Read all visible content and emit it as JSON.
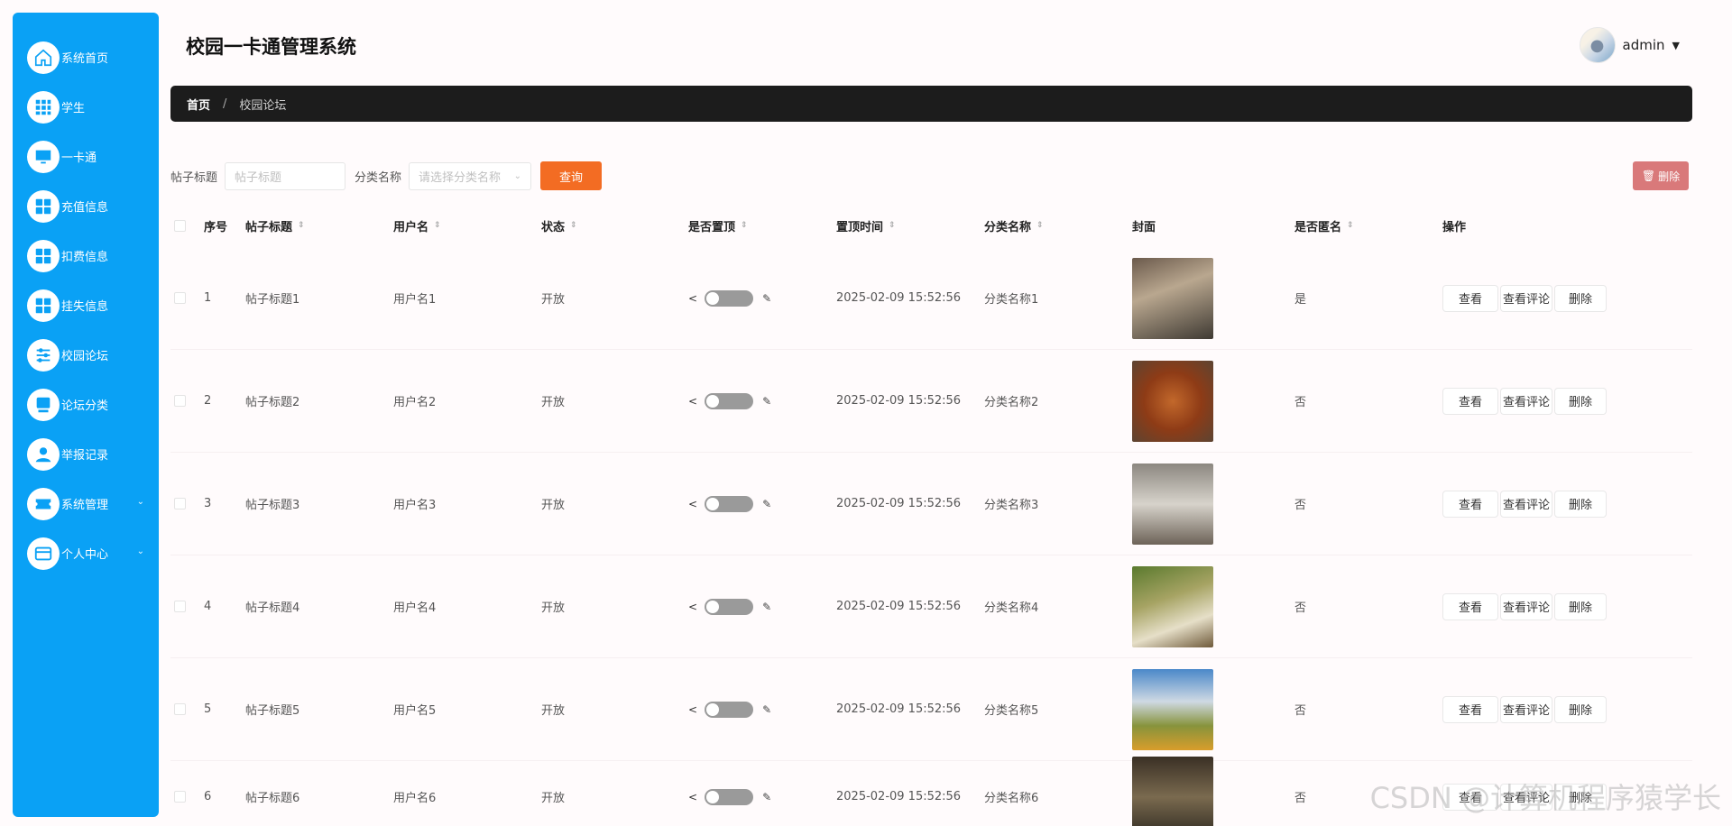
{
  "app": {
    "title": "校园一卡通管理系统"
  },
  "user": {
    "name": "admin"
  },
  "sidebar": {
    "items": [
      {
        "label": "系统首页",
        "icon": "home-icon"
      },
      {
        "label": "学生",
        "icon": "grid-dots-icon"
      },
      {
        "label": "一卡通",
        "icon": "monitor-icon"
      },
      {
        "label": "充值信息",
        "icon": "apps-icon"
      },
      {
        "label": "扣费信息",
        "icon": "apps-icon"
      },
      {
        "label": "挂失信息",
        "icon": "apps-icon"
      },
      {
        "label": "校园论坛",
        "icon": "sliders-icon"
      },
      {
        "label": "论坛分类",
        "icon": "monitor-icon"
      },
      {
        "label": "举报记录",
        "icon": "user-icon"
      },
      {
        "label": "系统管理",
        "icon": "ticket-icon",
        "expandable": true
      },
      {
        "label": "个人中心",
        "icon": "wallet-icon",
        "expandable": true
      }
    ]
  },
  "breadcrumb": {
    "home": "首页",
    "separator": "/",
    "current": "校园论坛"
  },
  "search": {
    "title_label": "帖子标题",
    "title_placeholder": "帖子标题",
    "category_label": "分类名称",
    "category_placeholder": "请选择分类名称",
    "query_button": "查询",
    "delete_button": "删除"
  },
  "table": {
    "headers": {
      "no": "序号",
      "title": "帖子标题",
      "user": "用户名",
      "status": "状态",
      "top": "是否置顶",
      "time": "置顶时间",
      "category": "分类名称",
      "cover": "封面",
      "anon": "是否匿名",
      "ops": "操作"
    },
    "rows": [
      {
        "no": "1",
        "title": "帖子标题1",
        "user": "用户名1",
        "status": "开放",
        "time": "2025-02-09 15:52:56",
        "category": "分类名称1",
        "anon": "是"
      },
      {
        "no": "2",
        "title": "帖子标题2",
        "user": "用户名2",
        "status": "开放",
        "time": "2025-02-09 15:52:56",
        "category": "分类名称2",
        "anon": "否"
      },
      {
        "no": "3",
        "title": "帖子标题3",
        "user": "用户名3",
        "status": "开放",
        "time": "2025-02-09 15:52:56",
        "category": "分类名称3",
        "anon": "否"
      },
      {
        "no": "4",
        "title": "帖子标题4",
        "user": "用户名4",
        "status": "开放",
        "time": "2025-02-09 15:52:56",
        "category": "分类名称4",
        "anon": "否"
      },
      {
        "no": "5",
        "title": "帖子标题5",
        "user": "用户名5",
        "status": "开放",
        "time": "2025-02-09 15:52:56",
        "category": "分类名称5",
        "anon": "否"
      },
      {
        "no": "6",
        "title": "帖子标题6",
        "user": "用户名6",
        "status": "开放",
        "time": "2025-02-09 15:52:56",
        "category": "分类名称6",
        "anon": "否"
      }
    ],
    "ops": {
      "view": "查看",
      "comments": "查看评论",
      "delete": "删除"
    }
  },
  "watermark": "CSDN @计算机程序猿学长",
  "colors": {
    "sidebar": "#0aa1f5",
    "query": "#f36c23",
    "delete": "#d9797a",
    "breadcrumb_bg": "#1c1c1c"
  }
}
